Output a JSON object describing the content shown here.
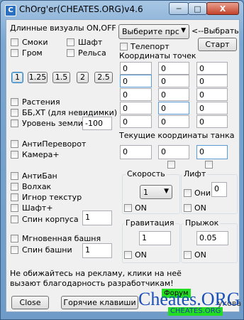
{
  "window": {
    "title": "ChOrg'er(CHEATES.ORG)v4.6",
    "minimize": "─",
    "maximize": "□",
    "close": "X"
  },
  "visuals": {
    "header": "Длинные визуалы ON,OFF",
    "smoke": "Смоки",
    "shaft": "Шафт",
    "grom": "Гром",
    "rails": "Рельса"
  },
  "speed_buttons": [
    "1",
    "1.25",
    "1.5",
    "2",
    "2.5"
  ],
  "plants": {
    "plants": "Растения",
    "bb_xt": "ББ,ХТ (для невидимки)",
    "ground_level": "Уровень земли",
    "ground_value": "-100"
  },
  "anti": {
    "anti_flip": "АнтиПереворот",
    "camera": "Камера+"
  },
  "misc": {
    "antiban": "АнтиБан",
    "volhak": "Волхак",
    "ignore_tex": "Игнор текстур",
    "shaft_plus": "Шафт+",
    "hull_spin": "Спин корпуса",
    "hull_spin_value": "1",
    "instant_turret": "Мгновенная башня",
    "turret_spin": "Спин башни",
    "turret_spin_value": "1"
  },
  "teleport": {
    "select_placeholder": "Выберите прс",
    "select_hint": "<--Выбрать",
    "start_button": "Старт",
    "teleport_label": "Телепорт",
    "coords_label": "Координаты точек",
    "coords": [
      [
        "0",
        "0",
        "0"
      ],
      [
        "0",
        "0",
        "0"
      ],
      [
        "0",
        "0",
        "0"
      ],
      [
        "0",
        "0",
        "0"
      ],
      [
        "0",
        "0",
        "0"
      ]
    ],
    "current_label": "Текущие координаты танка",
    "current": [
      "0",
      "0",
      "0"
    ]
  },
  "speed": {
    "title": "Скорость",
    "value": "1",
    "on": "ON"
  },
  "lift": {
    "title": "Лифт",
    "them": "Они",
    "value": "0",
    "on": "ON"
  },
  "gravity": {
    "title": "Гравитация",
    "value": "1",
    "on": "ON"
  },
  "jump": {
    "title": "Прыжок",
    "value": "0.05",
    "on": "ON"
  },
  "footer": {
    "note_line1": "Не обижайтесь на рекламу, клики на неё",
    "note_line2": "вызают благодарность разработчикам!",
    "close_button": "Close",
    "hotkeys_button": "Горячие клавиши",
    "forum": "Форум",
    "partial_label": "укова",
    "watermark": "Cheates.ORG",
    "watermark_sub": "CHEATES.ORG"
  }
}
